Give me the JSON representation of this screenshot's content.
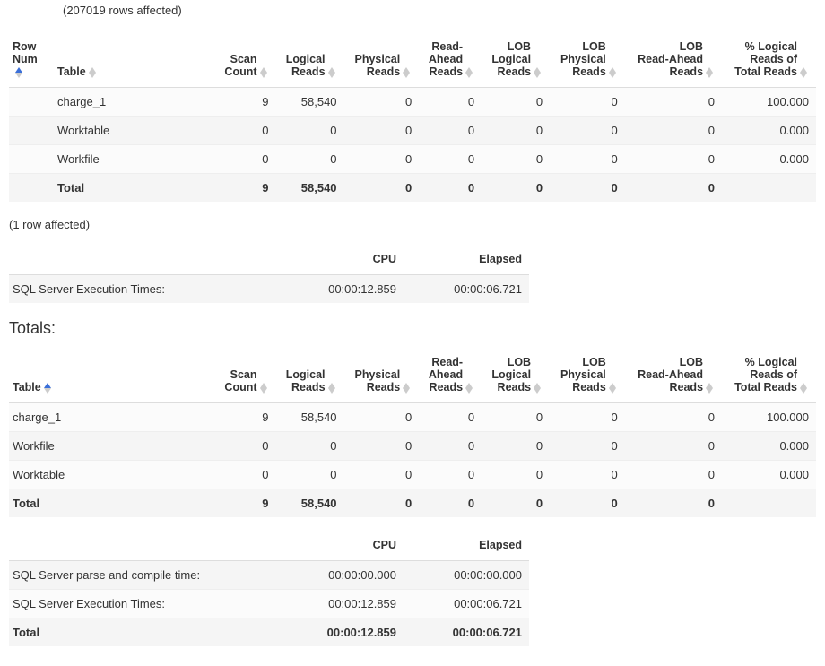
{
  "rows_affected_top": "(207019 rows affected)",
  "stats_columns": {
    "row_num": "Row Num",
    "table": "Table",
    "scan_count": "Scan Count",
    "logical_reads": "Logical Reads",
    "physical_reads": "Physical Reads",
    "read_ahead": "Read-Ahead Reads",
    "lob_logical": "LOB Logical Reads",
    "lob_physical": "LOB Physical Reads",
    "lob_read_ahead": "LOB Read-Ahead Reads",
    "pct_logical": "% Logical Reads of Total Reads"
  },
  "stats1": {
    "rows": [
      {
        "row_num": "",
        "table": "charge_1",
        "scan_count": "9",
        "logical_reads": "58,540",
        "physical_reads": "0",
        "read_ahead": "0",
        "lob_logical": "0",
        "lob_physical": "0",
        "lob_read_ahead": "0",
        "pct": "100.000"
      },
      {
        "row_num": "",
        "table": "Worktable",
        "scan_count": "0",
        "logical_reads": "0",
        "physical_reads": "0",
        "read_ahead": "0",
        "lob_logical": "0",
        "lob_physical": "0",
        "lob_read_ahead": "0",
        "pct": "0.000"
      },
      {
        "row_num": "",
        "table": "Workfile",
        "scan_count": "0",
        "logical_reads": "0",
        "physical_reads": "0",
        "read_ahead": "0",
        "lob_logical": "0",
        "lob_physical": "0",
        "lob_read_ahead": "0",
        "pct": "0.000"
      }
    ],
    "total": {
      "label": "Total",
      "scan_count": "9",
      "logical_reads": "58,540",
      "physical_reads": "0",
      "read_ahead": "0",
      "lob_logical": "0",
      "lob_physical": "0",
      "lob_read_ahead": "0",
      "pct": ""
    }
  },
  "one_row_affected": "(1 row affected)",
  "timing1": {
    "cols": {
      "cpu": "CPU",
      "elapsed": "Elapsed"
    },
    "rows": [
      {
        "label": "SQL Server Execution Times:",
        "cpu": "00:00:12.859",
        "elapsed": "00:00:06.721"
      }
    ]
  },
  "totals_label": "Totals:",
  "stats2": {
    "rows": [
      {
        "table": "charge_1",
        "scan_count": "9",
        "logical_reads": "58,540",
        "physical_reads": "0",
        "read_ahead": "0",
        "lob_logical": "0",
        "lob_physical": "0",
        "lob_read_ahead": "0",
        "pct": "100.000"
      },
      {
        "table": "Workfile",
        "scan_count": "0",
        "logical_reads": "0",
        "physical_reads": "0",
        "read_ahead": "0",
        "lob_logical": "0",
        "lob_physical": "0",
        "lob_read_ahead": "0",
        "pct": "0.000"
      },
      {
        "table": "Worktable",
        "scan_count": "0",
        "logical_reads": "0",
        "physical_reads": "0",
        "read_ahead": "0",
        "lob_logical": "0",
        "lob_physical": "0",
        "lob_read_ahead": "0",
        "pct": "0.000"
      }
    ],
    "total": {
      "label": "Total",
      "scan_count": "9",
      "logical_reads": "58,540",
      "physical_reads": "0",
      "read_ahead": "0",
      "lob_logical": "0",
      "lob_physical": "0",
      "lob_read_ahead": "0",
      "pct": ""
    }
  },
  "timing2": {
    "cols": {
      "cpu": "CPU",
      "elapsed": "Elapsed"
    },
    "rows": [
      {
        "label": "SQL Server parse and compile time:",
        "cpu": "00:00:00.000",
        "elapsed": "00:00:00.000"
      },
      {
        "label": "SQL Server Execution Times:",
        "cpu": "00:00:12.859",
        "elapsed": "00:00:06.721"
      }
    ],
    "total": {
      "label": "Total",
      "cpu": "00:00:12.859",
      "elapsed": "00:00:06.721"
    }
  }
}
